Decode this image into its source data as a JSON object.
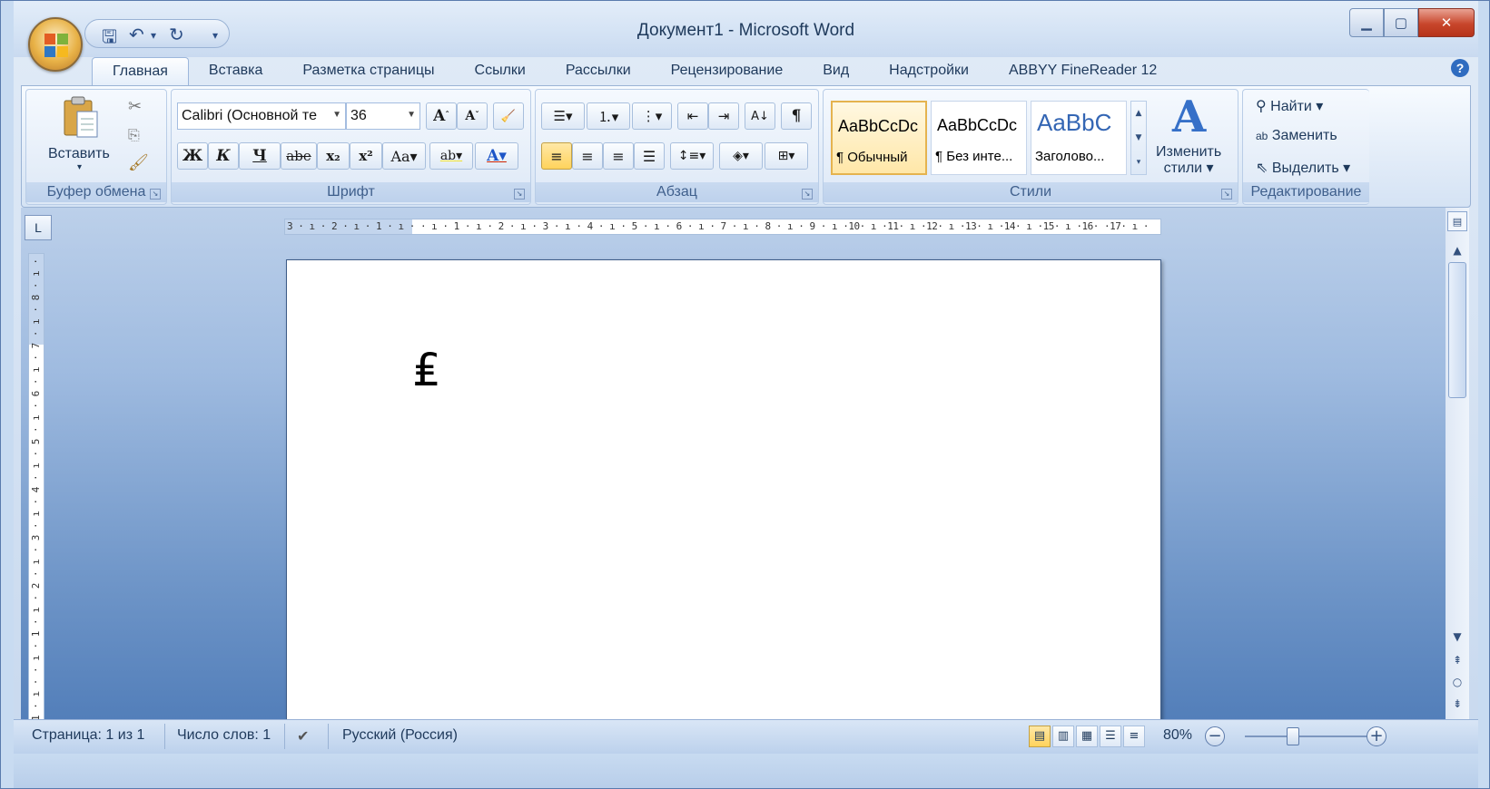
{
  "window": {
    "title": "Документ1 - Microsoft Word"
  },
  "qat": {
    "save_icon": "save-icon",
    "undo_icon": "undo-icon",
    "redo_icon": "redo-icon"
  },
  "tabs": [
    {
      "label": "Главная",
      "active": true
    },
    {
      "label": "Вставка"
    },
    {
      "label": "Разметка страницы"
    },
    {
      "label": "Ссылки"
    },
    {
      "label": "Рассылки"
    },
    {
      "label": "Рецензирование"
    },
    {
      "label": "Вид"
    },
    {
      "label": "Надстройки"
    },
    {
      "label": "ABBYY FineReader 12"
    }
  ],
  "clipboard": {
    "paste_label": "Вставить",
    "group_label": "Буфер обмена"
  },
  "font": {
    "font_name": "Calibri (Основной те",
    "font_size": "36",
    "bold": "Ж",
    "italic": "К",
    "underline": "Ч",
    "strike": "abe",
    "subscript": "x₂",
    "superscript": "x²",
    "case": "Aa",
    "grow": "A",
    "shrink": "A",
    "highlight": "ab",
    "color": "A",
    "group_label": "Шрифт"
  },
  "paragraph": {
    "pilcrow": "¶",
    "group_label": "Абзац"
  },
  "styles": {
    "items": [
      {
        "sample": "AaBbCcDc",
        "name": "¶ Обычный",
        "selected": true
      },
      {
        "sample": "AaBbCcDc",
        "name": "¶ Без инте..."
      },
      {
        "sample": "AaBbC",
        "name": "Заголово..."
      }
    ],
    "change_label_1": "Изменить",
    "change_label_2": "стили",
    "group_label": "Стили"
  },
  "editing": {
    "find": "Найти",
    "replace": "Заменить",
    "select": "Выделить",
    "group_label": "Редактирование"
  },
  "ruler": {
    "horizontal_text": "3 · ı · 2 · ı · 1 · ı ·   · ı · 1 · ı · 2 · ı · 3 · ı · 4 · ı · 5 · ı · 6 · ı · 7 · ı · 8 · ı · 9 · ı ·10· ı ·11· ı ·12· ı ·13· ı ·14· ı ·15· ı ·16·  ·17· ı ·",
    "vertical_text": "2 · ı · 1 · ı ·   · ı · 1 · ı · 2 · ı · 3 · ı · 4 · ı · 5 · ı · 6 · ı · 7 · ı · 8 · ı ·",
    "tab_stop": "L"
  },
  "document": {
    "content": "₤"
  },
  "statusbar": {
    "page": "Страница: 1 из 1",
    "words": "Число слов: 1",
    "language": "Русский (Россия)",
    "zoom": "80%"
  }
}
